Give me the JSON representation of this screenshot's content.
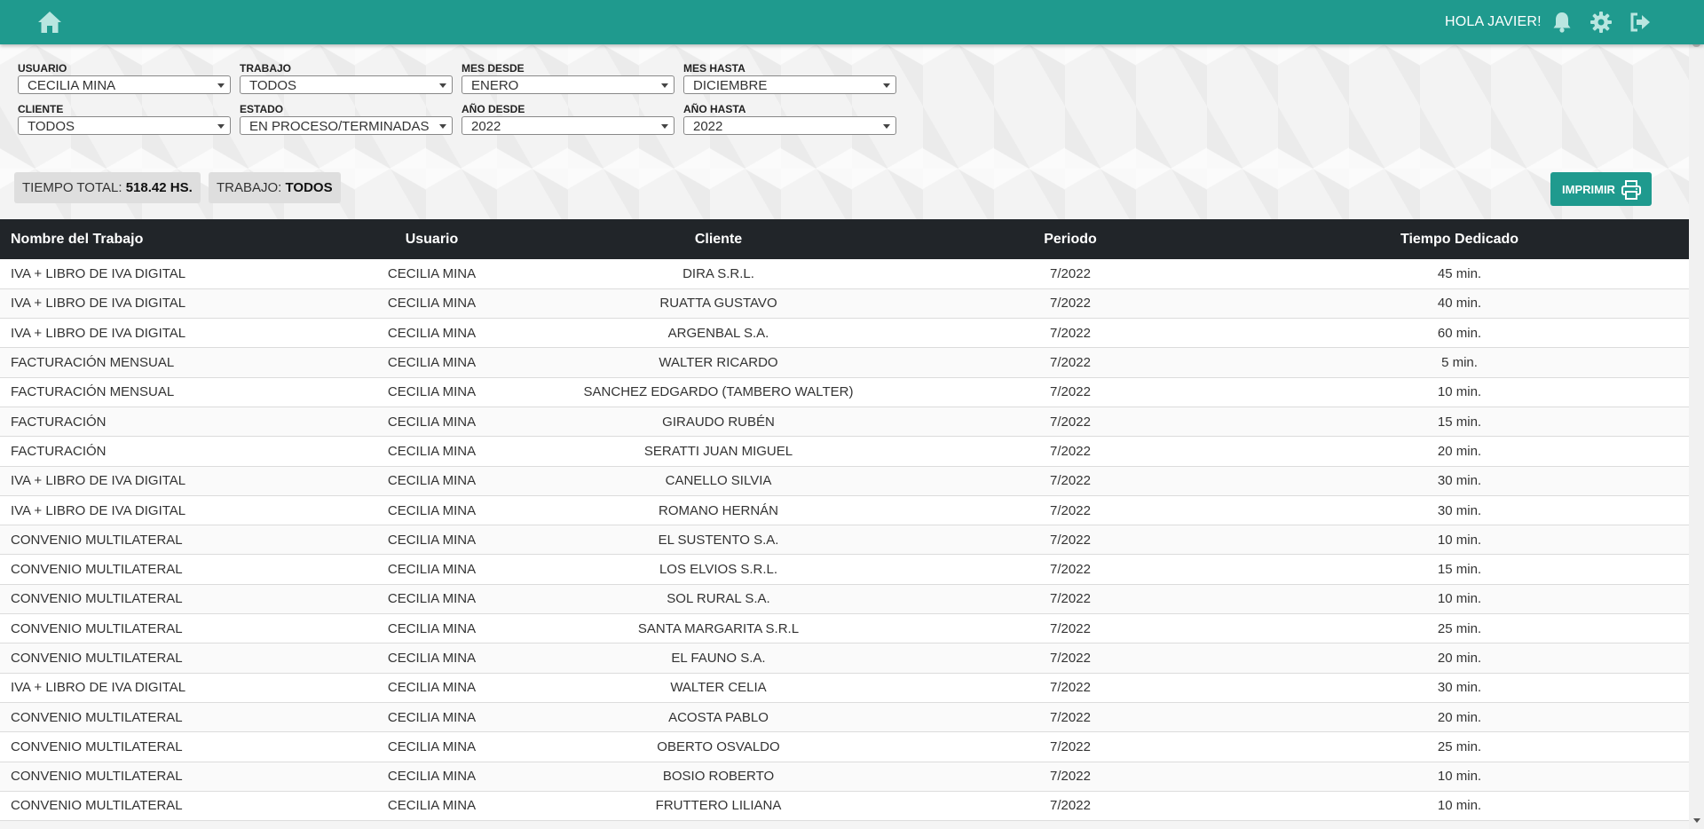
{
  "header": {
    "greeting": "HOLA JAVIER!",
    "icons": [
      "home-icon",
      "bell-icon",
      "gear-icon",
      "logout-icon"
    ],
    "bg_color": "#1f9a8e"
  },
  "filters": {
    "usuario": {
      "label": "USUARIO",
      "value": "CECILIA MINA"
    },
    "trabajo": {
      "label": "TRABAJO",
      "value": "TODOS"
    },
    "mes_desde": {
      "label": "MES DESDE",
      "value": "ENERO"
    },
    "mes_hasta": {
      "label": "MES HASTA",
      "value": "DICIEMBRE"
    },
    "cliente": {
      "label": "CLIENTE",
      "value": "TODOS"
    },
    "estado": {
      "label": "ESTADO",
      "value": "EN PROCESO/TERMINADAS"
    },
    "anio_desde": {
      "label": "AÑO DESDE",
      "value": "2022"
    },
    "anio_hasta": {
      "label": "AÑO HASTA",
      "value": "2022"
    }
  },
  "summary": {
    "tiempo_label": "TIEMPO TOTAL:",
    "tiempo_value": "518.42 HS.",
    "trabajo_label": "TRABAJO:",
    "trabajo_value": "TODOS"
  },
  "print_button": {
    "label": "IMPRIMIR",
    "icon": "printer-icon"
  },
  "table": {
    "headers": [
      "Nombre del Trabajo",
      "Usuario",
      "Cliente",
      "Periodo",
      "Tiempo Dedicado"
    ],
    "rows": [
      [
        "IVA + LIBRO DE IVA DIGITAL",
        "CECILIA MINA",
        "DIRA S.R.L.",
        "7/2022",
        "45 min."
      ],
      [
        "IVA + LIBRO DE IVA DIGITAL",
        "CECILIA MINA",
        "RUATTA GUSTAVO",
        "7/2022",
        "40 min."
      ],
      [
        "IVA + LIBRO DE IVA DIGITAL",
        "CECILIA MINA",
        "ARGENBAL S.A.",
        "7/2022",
        "60 min."
      ],
      [
        "FACTURACIÓN MENSUAL",
        "CECILIA MINA",
        "WALTER RICARDO",
        "7/2022",
        "5 min."
      ],
      [
        "FACTURACIÓN MENSUAL",
        "CECILIA MINA",
        "SANCHEZ EDGARDO (TAMBERO WALTER)",
        "7/2022",
        "10 min."
      ],
      [
        "FACTURACIÓN",
        "CECILIA MINA",
        "GIRAUDO RUBÉN",
        "7/2022",
        "15 min."
      ],
      [
        "FACTURACIÓN",
        "CECILIA MINA",
        "SERATTI JUAN MIGUEL",
        "7/2022",
        "20 min."
      ],
      [
        "IVA + LIBRO DE IVA DIGITAL",
        "CECILIA MINA",
        "CANELLO SILVIA",
        "7/2022",
        "30 min."
      ],
      [
        "IVA + LIBRO DE IVA DIGITAL",
        "CECILIA MINA",
        "ROMANO HERNÁN",
        "7/2022",
        "30 min."
      ],
      [
        "CONVENIO MULTILATERAL",
        "CECILIA MINA",
        "EL SUSTENTO S.A.",
        "7/2022",
        "10 min."
      ],
      [
        "CONVENIO MULTILATERAL",
        "CECILIA MINA",
        "LOS ELVIOS S.R.L.",
        "7/2022",
        "15 min."
      ],
      [
        "CONVENIO MULTILATERAL",
        "CECILIA MINA",
        "SOL RURAL S.A.",
        "7/2022",
        "10 min."
      ],
      [
        "CONVENIO MULTILATERAL",
        "CECILIA MINA",
        "SANTA MARGARITA S.R.L",
        "7/2022",
        "25 min."
      ],
      [
        "CONVENIO MULTILATERAL",
        "CECILIA MINA",
        "EL FAUNO S.A.",
        "7/2022",
        "20 min."
      ],
      [
        "IVA + LIBRO DE IVA DIGITAL",
        "CECILIA MINA",
        "WALTER CELIA",
        "7/2022",
        "30 min."
      ],
      [
        "CONVENIO MULTILATERAL",
        "CECILIA MINA",
        "ACOSTA PABLO",
        "7/2022",
        "20 min."
      ],
      [
        "CONVENIO MULTILATERAL",
        "CECILIA MINA",
        "OBERTO OSVALDO",
        "7/2022",
        "25 min."
      ],
      [
        "CONVENIO MULTILATERAL",
        "CECILIA MINA",
        "BOSIO ROBERTO",
        "7/2022",
        "10 min."
      ],
      [
        "CONVENIO MULTILATERAL",
        "CECILIA MINA",
        "FRUTTERO LILIANA",
        "7/2022",
        "10 min."
      ]
    ]
  }
}
